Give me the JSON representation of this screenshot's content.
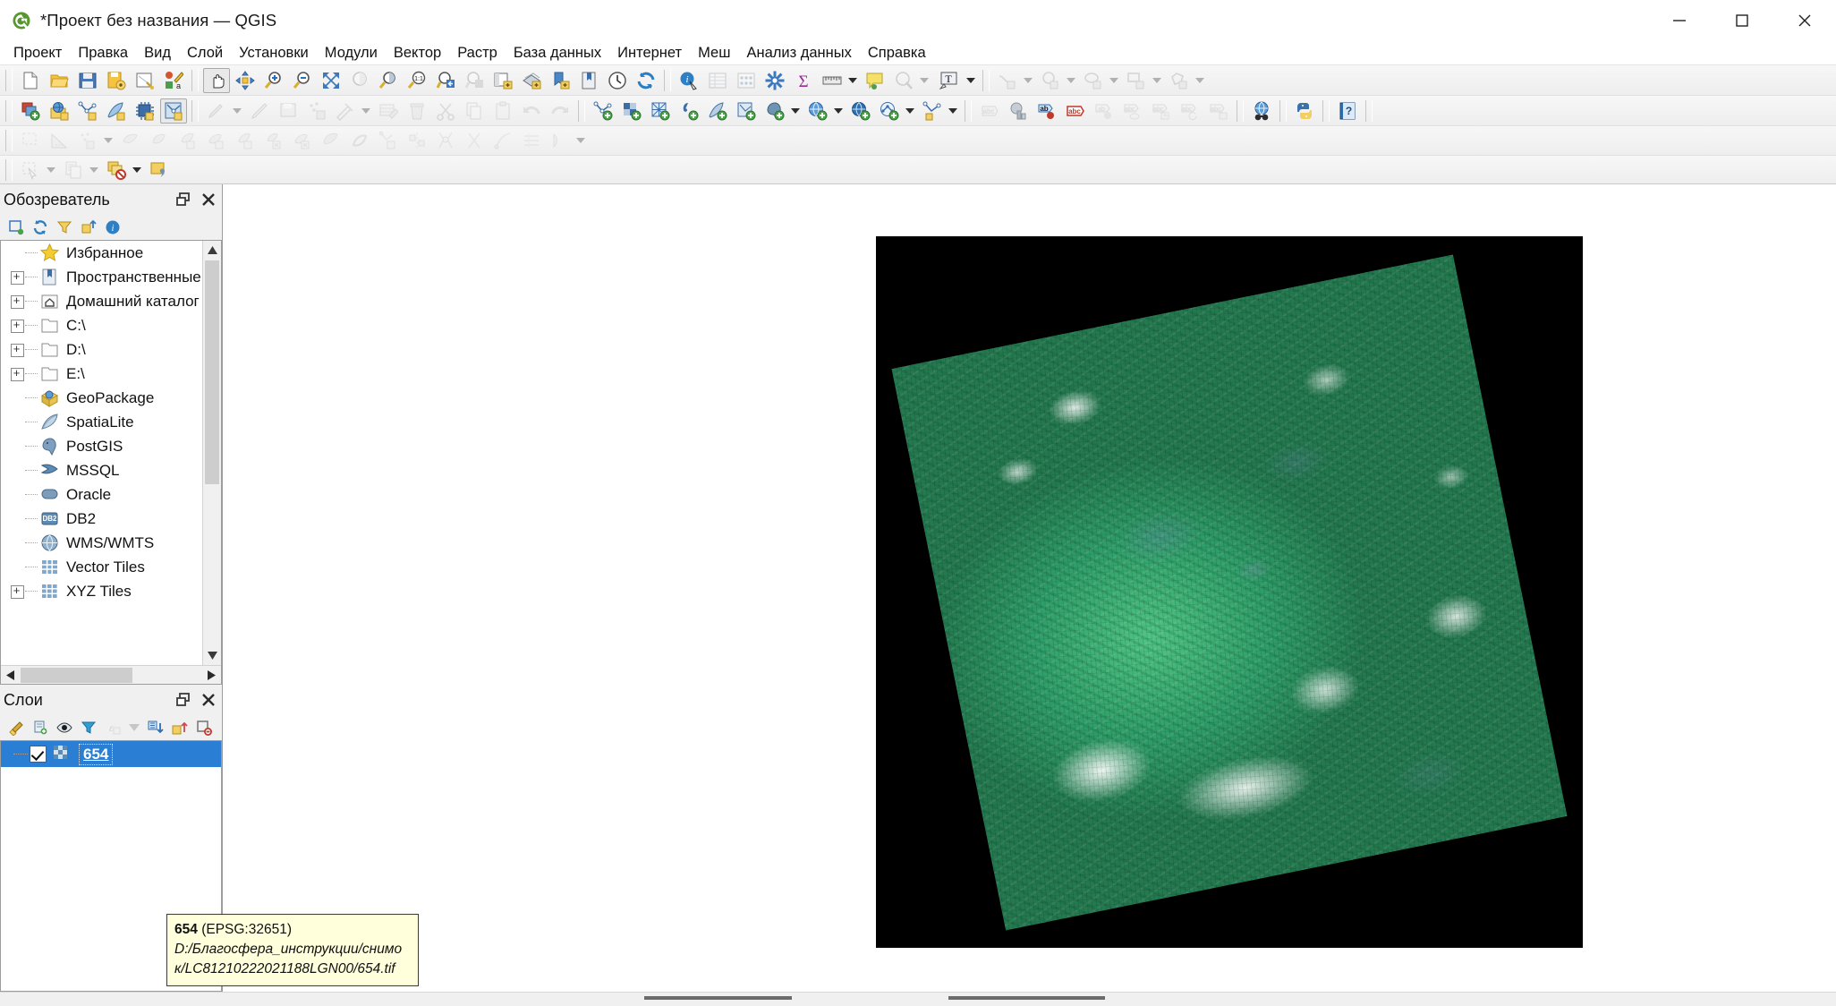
{
  "window": {
    "title": "*Проект без названия — QGIS",
    "logo_icon": "qgis-logo-icon",
    "controls": {
      "minimize": "minimize-icon",
      "maximize": "maximize-icon",
      "close": "close-icon"
    }
  },
  "menubar": {
    "items": [
      "Проект",
      "Правка",
      "Вид",
      "Слой",
      "Установки",
      "Модули",
      "Вектор",
      "Растр",
      "База данных",
      "Интернет",
      "Меш",
      "Анализ данных",
      "Справка"
    ]
  },
  "toolbars": {
    "row1": [
      "new-project-icon",
      "open-project-icon",
      "save-project-icon",
      "save-project-as-icon",
      "new-print-layout-icon",
      "style-manager-icon",
      "pan-map-icon",
      "pan-to-selection-icon",
      "zoom-in-icon",
      "zoom-out-icon",
      "zoom-full-icon",
      "zoom-to-selection-icon",
      "zoom-to-layer-icon",
      "zoom-native-icon",
      "zoom-last-icon",
      "zoom-next-icon",
      "new-map-view-icon",
      "new-3d-map-view-icon",
      "bookmark-add-icon",
      "show-bookmarks-icon",
      "temporal-controller-icon",
      "refresh-icon",
      "identify-features-icon",
      "open-attribute-table-icon",
      "field-calculator-icon",
      "processing-toolbox-icon",
      "statistical-summary-icon",
      "measure-line-icon",
      "map-tips-icon",
      "show-hide-map-tips-icon",
      "new-text-annotation-icon",
      "annotation-tools-icon"
    ],
    "row2": [
      "add-layer-group-icon",
      "open-data-source-manager-icon",
      "vertex-tool-icon",
      "add-feature-icon",
      "processing-icon",
      "topology-checker-icon",
      "current-edits-icon",
      "toggle-editing-icon",
      "save-layer-edits-icon",
      "add-point-feature-icon",
      "modify-attributes-icon",
      "multi-edit-icon",
      "delete-selected-icon",
      "cut-features-icon",
      "copy-features-icon",
      "paste-features-icon",
      "undo-icon",
      "redo-icon",
      "add-vector-layer-icon",
      "add-raster-layer-icon",
      "add-mesh-layer-icon",
      "add-delimited-text-layer-icon",
      "add-spatialite-layer-icon",
      "add-vector-tile-layer-icon",
      "add-postgis-layer-icon",
      "add-wms-layer-icon",
      "add-wfs-layer-icon",
      "add-wcs-layer-icon",
      "add-gps-layer-icon",
      "label-toolbar-icon",
      "layer-diagram-icon",
      "highlight-pinned-labels-icon",
      "pin-labels-icon",
      "show-hide-labels-icon",
      "move-label-icon",
      "rotate-label-icon",
      "change-label-icon",
      "metasearch-icon",
      "python-console-icon",
      "help-icon"
    ],
    "row3": [
      "select-features-icon",
      "measure-area-icon",
      "add-circular-string-icon",
      "rotate-feature-icon",
      "simplify-feature-icon",
      "add-ring-icon",
      "add-part-icon",
      "fill-ring-icon",
      "delete-ring-icon",
      "delete-part-icon",
      "reshape-features-icon",
      "offset-curve-icon",
      "split-features-icon",
      "split-parts-icon",
      "merge-features-icon",
      "merge-attributes-icon",
      "rotate-point-symbols-icon",
      "offset-point-symbol-icon",
      "trim-extend-feature-icon",
      "vertex-tool-all-icon"
    ],
    "row4": [
      "select-by-rectangle-icon",
      "select-by-expression-icon",
      "deselect-features-icon",
      "select-value-icon"
    ]
  },
  "browser_panel": {
    "title": "Обозреватель",
    "float_icon": "float-panel-icon",
    "close_icon": "close-panel-icon",
    "tools": [
      "add-selected-layers-icon",
      "refresh-icon",
      "filter-browser-icon",
      "collapse-all-icon",
      "enable-properties-icon"
    ],
    "items": [
      {
        "label": "Избранное",
        "icon": "star-icon",
        "expandable": false
      },
      {
        "label": "Пространственные закладки",
        "icon": "bookmark-icon",
        "expandable": true
      },
      {
        "label": "Домашний каталог",
        "icon": "home-folder-icon",
        "expandable": true
      },
      {
        "label": "C:\\",
        "icon": "folder-icon",
        "expandable": true
      },
      {
        "label": "D:\\",
        "icon": "folder-icon",
        "expandable": true
      },
      {
        "label": "E:\\",
        "icon": "folder-icon",
        "expandable": true
      },
      {
        "label": "GeoPackage",
        "icon": "geopackage-icon",
        "expandable": false
      },
      {
        "label": "SpatiaLite",
        "icon": "spatialite-icon",
        "expandable": false
      },
      {
        "label": "PostGIS",
        "icon": "postgis-icon",
        "expandable": false
      },
      {
        "label": "MSSQL",
        "icon": "mssql-icon",
        "expandable": false
      },
      {
        "label": "Oracle",
        "icon": "oracle-icon",
        "expandable": false
      },
      {
        "label": "DB2",
        "icon": "db2-icon",
        "expandable": false
      },
      {
        "label": "WMS/WMTS",
        "icon": "wms-icon",
        "expandable": false
      },
      {
        "label": "Vector Tiles",
        "icon": "vector-tiles-icon",
        "expandable": false
      },
      {
        "label": "XYZ Tiles",
        "icon": "xyz-tiles-icon",
        "expandable": true
      }
    ]
  },
  "layers_panel": {
    "title": "Слои",
    "float_icon": "float-panel-icon",
    "close_icon": "close-panel-icon",
    "tools": [
      "open-layer-styling-icon",
      "add-group-icon",
      "manage-visibility-icon",
      "filter-legend-icon",
      "filter-legend-expression-icon",
      "expand-all-icon",
      "collapse-all-icon",
      "remove-layer-icon"
    ],
    "layers": [
      {
        "name": "654",
        "icon": "raster-layer-icon",
        "checked": true,
        "selected": true
      }
    ]
  },
  "tooltip": {
    "name": "654",
    "crs": "(EPSG:32651)",
    "path": "D:/Благосфера_инструкции/снимок/LC81210222021188LGN00/654.tif"
  },
  "map": {
    "layer_name": "654",
    "background_color": "#ffffff",
    "nodata_color": "#000000",
    "accent_color": "#2a7fd4"
  },
  "statusbar": {
    "visible_blocks": 2
  }
}
